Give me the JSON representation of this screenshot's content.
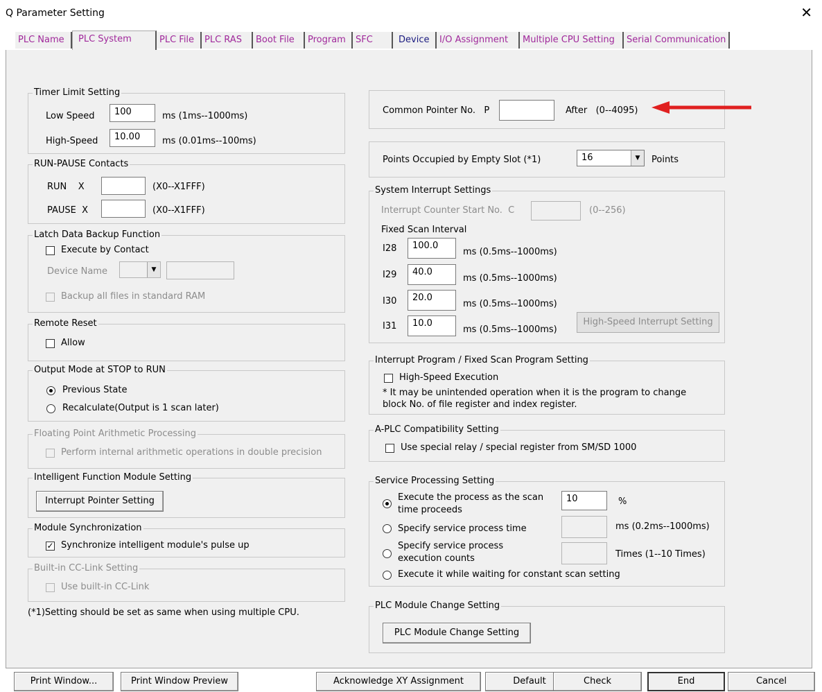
{
  "window": {
    "title": "Q Parameter Setting",
    "close_glyph": "✕"
  },
  "tabs": [
    {
      "label": "PLC Name"
    },
    {
      "label": "PLC System"
    },
    {
      "label": "PLC File"
    },
    {
      "label": "PLC RAS"
    },
    {
      "label": "Boot File"
    },
    {
      "label": "Program"
    },
    {
      "label": "SFC"
    },
    {
      "label": "Device"
    },
    {
      "label": "I/O Assignment"
    },
    {
      "label": "Multiple CPU Setting"
    },
    {
      "label": "Serial Communication"
    }
  ],
  "timer": {
    "group_label": "Timer Limit Setting",
    "low_label": "Low Speed",
    "low_value": "100",
    "low_unit": "ms  (1ms--1000ms)",
    "high_label": "High-Speed",
    "high_value": "10.00",
    "high_unit": "ms  (0.01ms--100ms)"
  },
  "runpause": {
    "group_label": "RUN-PAUSE Contacts",
    "run_label": "RUN    X",
    "run_value": "",
    "run_range": "(X0--X1FFF)",
    "pause_label": "PAUSE  X",
    "pause_value": "",
    "pause_range": "(X0--X1FFF)"
  },
  "latch": {
    "group_label": "Latch Data Backup Function",
    "execute_label": "Execute by Contact",
    "device_label": "Device Name",
    "backup_label": "Backup all files in standard RAM"
  },
  "remote": {
    "group_label": "Remote Reset",
    "allow_label": "Allow"
  },
  "output": {
    "group_label": "Output Mode at STOP to RUN",
    "prev_label": "Previous State",
    "recalc_label": "Recalculate(Output is 1 scan later)"
  },
  "floating": {
    "group_label": "Floating Point Arithmetic Processing",
    "perform_label": "Perform internal arithmetic operations in double precision"
  },
  "intelligent": {
    "group_label": "Intelligent Function Module Setting",
    "button_label": "Interrupt Pointer Setting"
  },
  "modsync": {
    "group_label": "Module Synchronization",
    "sync_label": "Synchronize intelligent module's pulse up",
    "sync_check": "✓"
  },
  "ccl": {
    "group_label": "Built-in CC-Link Setting",
    "use_label": "Use built-in CC-Link"
  },
  "footnote": "(*1)Setting should be set as same when using multiple CPU.",
  "common_pointer": {
    "label": "Common Pointer No.   P",
    "value": "",
    "after": "After   (0--4095)"
  },
  "empty_slot": {
    "label": "Points Occupied by Empty Slot  (*1)",
    "value": "16",
    "unit": "Points"
  },
  "sysint": {
    "group_label": "System Interrupt Settings",
    "counter_label": "Interrupt Counter Start No.  C",
    "counter_range": "(0--256)",
    "fixed_label": "Fixed Scan Interval",
    "rows": [
      {
        "name": "I28",
        "value": "100.0",
        "unit": "ms  (0.5ms--1000ms)"
      },
      {
        "name": "I29",
        "value": "40.0",
        "unit": "ms  (0.5ms--1000ms)"
      },
      {
        "name": "I30",
        "value": "20.0",
        "unit": "ms  (0.5ms--1000ms)"
      },
      {
        "name": "I31",
        "value": "10.0",
        "unit": "ms  (0.5ms--1000ms)"
      }
    ],
    "hs_button": "High-Speed Interrupt Setting"
  },
  "intprog": {
    "group_label": "Interrupt Program / Fixed Scan Program Setting",
    "hs_label": "High-Speed Execution",
    "note1": "* It may be unintended operation when it is the program to change",
    "note2": "block No. of file register and index register."
  },
  "aplc": {
    "group_label": "A-PLC Compatibility Setting",
    "use_label": "Use special relay / special register from SM/SD 1000"
  },
  "service": {
    "group_label": "Service Processing Setting",
    "opt1_a": "Execute the process as the scan",
    "opt1_b": "time proceeds",
    "opt1_value": "10",
    "opt1_unit": "%",
    "opt2": "Specify service process time",
    "opt2_unit": "ms (0.2ms--1000ms)",
    "opt3_a": "Specify service process",
    "opt3_b": "execution counts",
    "opt3_unit": "Times (1--10 Times)",
    "opt4": "Execute it while waiting for constant scan setting"
  },
  "plcchange": {
    "group_label": "PLC Module Change Setting",
    "button_label": "PLC Module Change Setting"
  },
  "bottom": {
    "print": "Print Window...",
    "preview": "Print Window Preview",
    "ack": "Acknowledge XY Assignment",
    "default": "Default",
    "check": "Check",
    "end": "End",
    "cancel": "Cancel"
  },
  "colors": {
    "tab_text": "#a0289b",
    "arrow": "#e02020",
    "panel_bg": "#f0f0f0"
  }
}
